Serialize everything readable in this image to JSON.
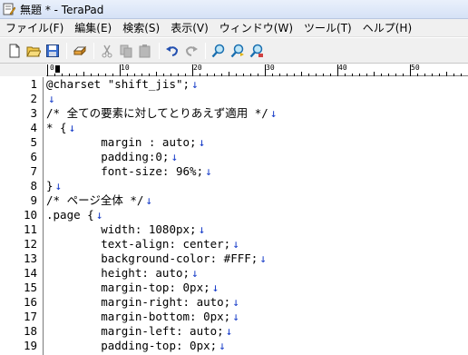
{
  "window": {
    "title": "無題 * - TeraPad"
  },
  "menu": [
    "ファイル(F)",
    "編集(E)",
    "検索(S)",
    "表示(V)",
    "ウィンドウ(W)",
    "ツール(T)",
    "ヘルプ(H)"
  ],
  "toolbar": {
    "buttons": [
      "new-file-icon",
      "open-folder-icon",
      "save-icon",
      "print-icon",
      "cut-icon",
      "copy-icon",
      "paste-icon",
      "undo-icon",
      "redo-icon",
      "search-icon",
      "search-next-icon",
      "replace-icon"
    ]
  },
  "ruler": {
    "labels": [
      "0",
      "10",
      "20",
      "30",
      "40",
      "50"
    ]
  },
  "editor": {
    "eol_mark": "↓",
    "lines": [
      {
        "num": "1",
        "text": "@charset \"shift_jis\";"
      },
      {
        "num": "2",
        "text": ""
      },
      {
        "num": "3",
        "text": "/* 全ての要素に対してとりあえず適用 */"
      },
      {
        "num": "4",
        "text": "* {"
      },
      {
        "num": "5",
        "text": "        margin : auto;"
      },
      {
        "num": "6",
        "text": "        padding:0;"
      },
      {
        "num": "7",
        "text": "        font-size: 96%;"
      },
      {
        "num": "8",
        "text": "}"
      },
      {
        "num": "9",
        "text": "/* ページ全体 */"
      },
      {
        "num": "10",
        "text": ".page {"
      },
      {
        "num": "11",
        "text": "        width: 1080px;"
      },
      {
        "num": "12",
        "text": "        text-align: center;"
      },
      {
        "num": "13",
        "text": "        background-color: #FFF;"
      },
      {
        "num": "14",
        "text": "        height: auto;"
      },
      {
        "num": "15",
        "text": "        margin-top: 0px;"
      },
      {
        "num": "16",
        "text": "        margin-right: auto;"
      },
      {
        "num": "17",
        "text": "        margin-bottom: 0px;"
      },
      {
        "num": "18",
        "text": "        margin-left: auto;"
      },
      {
        "num": "19",
        "text": "        padding-top: 0px;"
      }
    ]
  }
}
